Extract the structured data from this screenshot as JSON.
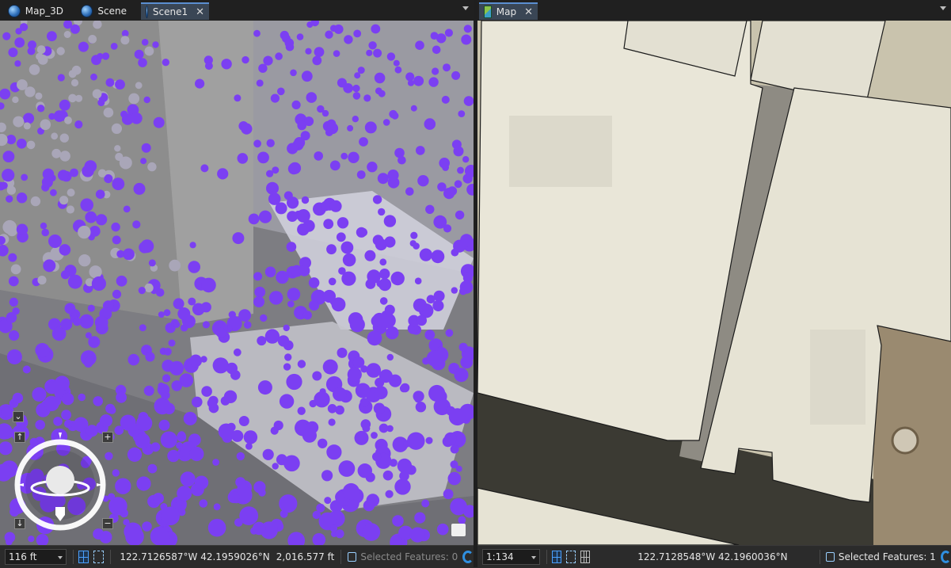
{
  "left_view": {
    "tabs": [
      {
        "label": "Map_3D",
        "icon": "globe-icon",
        "active": false
      },
      {
        "label": "Scene",
        "icon": "globe-icon",
        "active": false
      },
      {
        "label": "Scene1",
        "icon": "globe-icon",
        "active": true,
        "closable": true
      }
    ],
    "status": {
      "scale": "116 ft",
      "coordinates": "122.7126587°W 42.1959026°N",
      "elevation": "2,016.577 ft",
      "selected_features": "Selected Features: 0"
    },
    "navigator": {
      "icons": [
        "navigator-collapse-icon",
        "tilt-up-icon",
        "zoom-in-icon",
        "tilt-down-icon",
        "zoom-out-icon",
        "heading-indicator-icon"
      ]
    }
  },
  "right_view": {
    "tabs": [
      {
        "label": "Map",
        "icon": "map-icon",
        "active": true,
        "closable": true
      }
    ],
    "status": {
      "scale": "1:134",
      "coordinates": "122.7128548°W 42.1960036°N",
      "selected_features": "Selected Features: 1"
    }
  },
  "colors": {
    "point_purple": "#7b3ff2",
    "building_gray": "#8c8c8c",
    "footprint_fill": "#e9e6d8",
    "accent_blue": "#2f8fe0"
  }
}
